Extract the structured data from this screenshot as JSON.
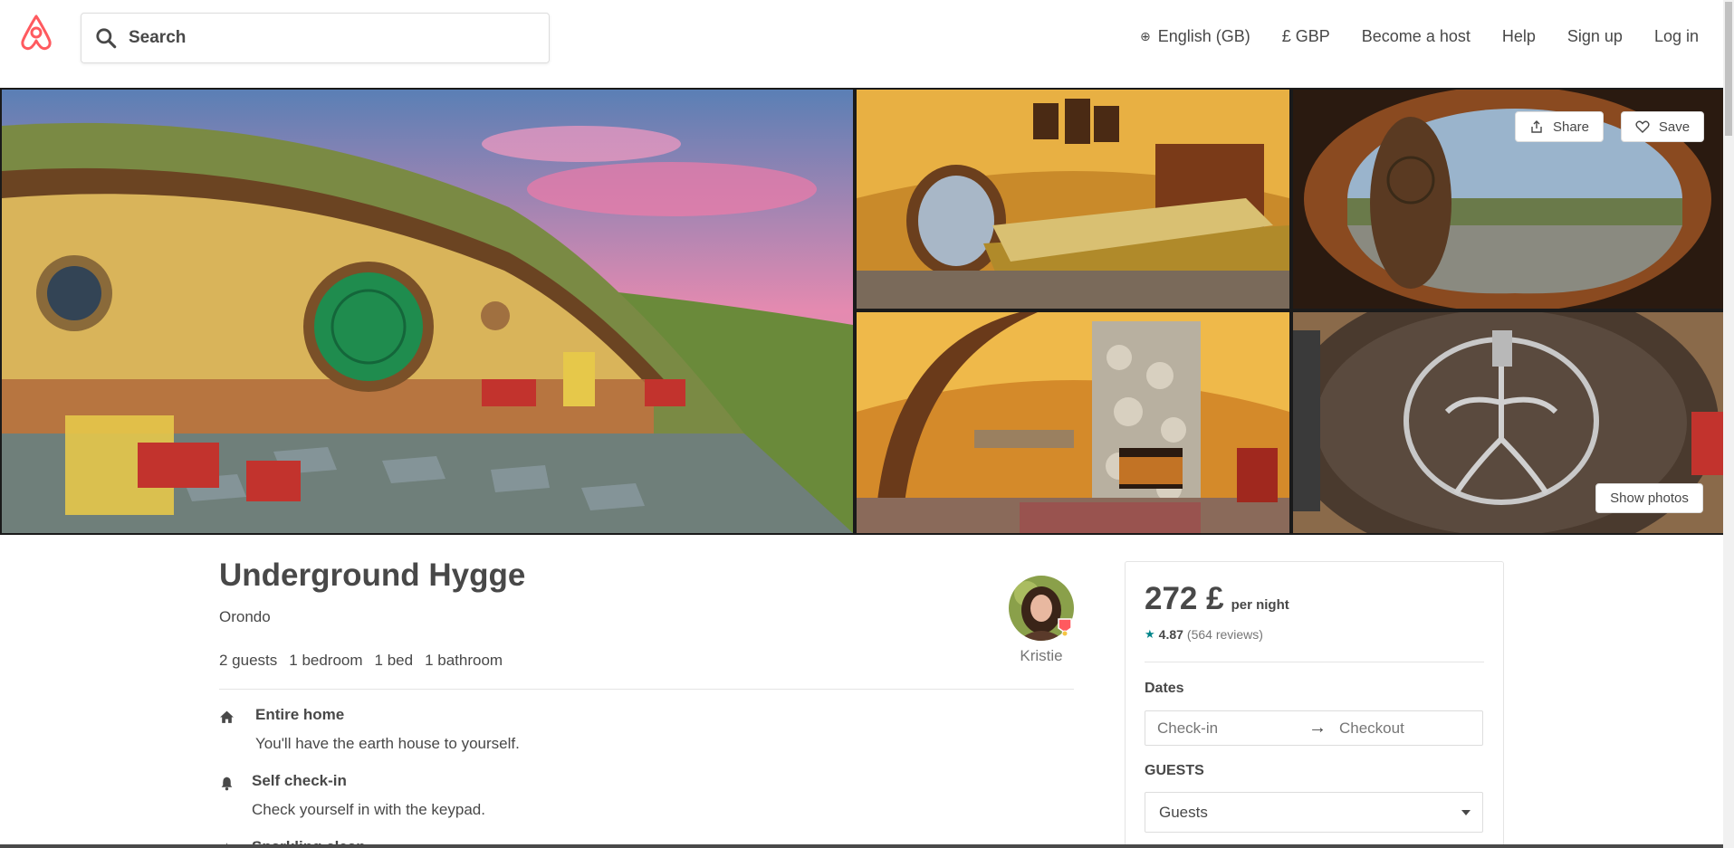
{
  "header": {
    "search_placeholder": "Search",
    "nav": {
      "language": "English (GB)",
      "currency": "£ GBP",
      "become_host": "Become a host",
      "help": "Help",
      "signup": "Sign up",
      "login": "Log in"
    }
  },
  "photos": {
    "share_label": "Share",
    "save_label": "Save",
    "show_photos_label": "Show photos"
  },
  "listing": {
    "title": "Underground Hygge",
    "location": "Orondo",
    "stats": [
      "2 guests",
      "1 bedroom",
      "1 bed",
      "1 bathroom"
    ],
    "host_name": "Kristie",
    "features": [
      {
        "icon": "home-icon",
        "title": "Entire home",
        "desc": "You'll have the earth house to yourself."
      },
      {
        "icon": "bell-icon",
        "title": "Self check-in",
        "desc": "Check yourself in with the keypad."
      },
      {
        "icon": "sparkle-icon",
        "title": "Sparkling clean"
      }
    ]
  },
  "booking": {
    "price": "272 £",
    "per_night": "per night",
    "rating": "4.87",
    "reviews": "(564 reviews)",
    "dates_label": "Dates",
    "checkin_placeholder": "Check-in",
    "checkout_placeholder": "Checkout",
    "guests_label": "GUESTS",
    "guests_value": "Guests"
  },
  "colors": {
    "brand": "#FF5A5F",
    "text": "#484848",
    "muted": "#767676",
    "accent": "#008489"
  }
}
